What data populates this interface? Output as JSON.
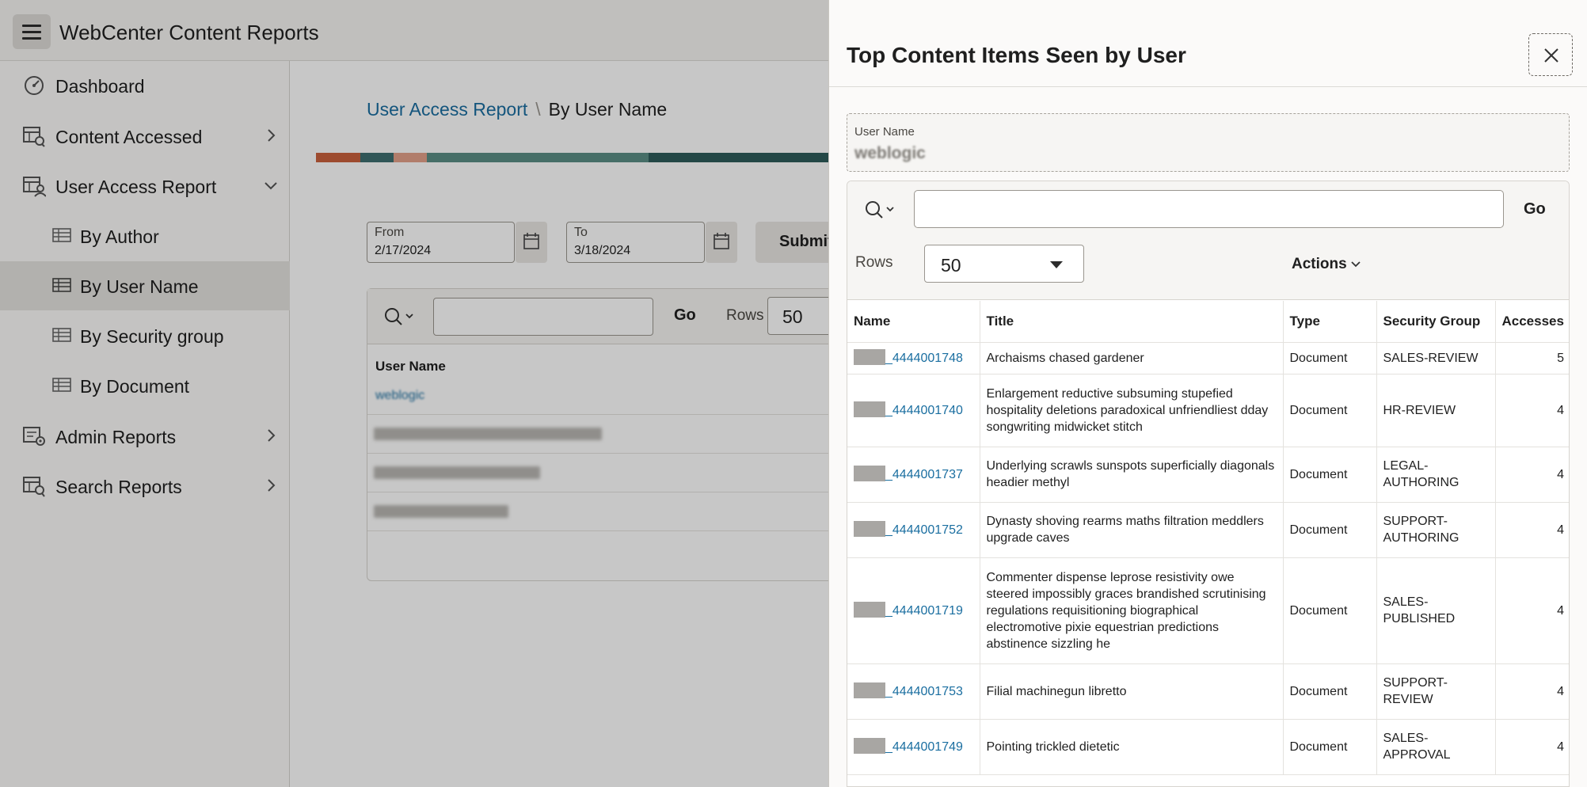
{
  "app": {
    "title": "WebCenter Content Reports"
  },
  "sidebar": {
    "items": [
      {
        "label": "Dashboard",
        "icon": "dashboard-icon"
      },
      {
        "label": "Content Accessed",
        "icon": "report-icon"
      },
      {
        "label": "User Access Report",
        "icon": "user-report-icon"
      },
      {
        "label": "By Author",
        "icon": "table-icon"
      },
      {
        "label": "By User Name",
        "icon": "table-icon"
      },
      {
        "label": "By Security group",
        "icon": "table-icon"
      },
      {
        "label": "By Document",
        "icon": "table-icon"
      },
      {
        "label": "Admin Reports",
        "icon": "admin-report-icon"
      },
      {
        "label": "Search Reports",
        "icon": "search-report-icon"
      }
    ]
  },
  "main": {
    "breadcrumb": {
      "parent": "User Access Report",
      "separator": "\\",
      "current": "By User Name"
    },
    "from": {
      "label": "From",
      "value": "2/17/2024"
    },
    "to": {
      "label": "To",
      "value": "3/18/2024"
    },
    "submit_label": "Submit",
    "report": {
      "go_label": "Go",
      "rows_label": "Rows",
      "rows_value": "50",
      "column": "User Name",
      "first_user": "weblogic"
    }
  },
  "drawer": {
    "title": "Top Content Items Seen by User",
    "user_name_label": "User Name",
    "user_name_value": "weblogic",
    "search_placeholder": "",
    "go_label": "Go",
    "rows_label": "Rows",
    "rows_value": "50",
    "actions_label": "Actions",
    "columns": [
      "Name",
      "Title",
      "Type",
      "Security Group",
      "Accesses"
    ],
    "rows": [
      {
        "name": "_4444001748",
        "title": "Archaisms chased gardener",
        "type": "Document",
        "group": "SALES-REVIEW",
        "accesses": "5"
      },
      {
        "name": "_4444001740",
        "title": "Enlargement reductive subsuming stupefied hospitality deletions paradoxical unfriendliest dday songwriting midwicket stitch",
        "type": "Document",
        "group": "HR-REVIEW",
        "accesses": "4"
      },
      {
        "name": "_4444001737",
        "title": "Underlying scrawls sunspots superficially diagonals headier methyl",
        "type": "Document",
        "group": "LEGAL-AUTHORING",
        "accesses": "4"
      },
      {
        "name": "_4444001752",
        "title": "Dynasty shoving rearms maths filtration meddlers upgrade caves",
        "type": "Document",
        "group": "SUPPORT-AUTHORING",
        "accesses": "4"
      },
      {
        "name": "_4444001719",
        "title": "Commenter dispense leprose resistivity owe steered impossibly graces brandished scrutinising regulations requisitioning biographical electromotive pixie equestrian predictions abstinence sizzling he",
        "type": "Document",
        "group": "SALES-PUBLISHED",
        "accesses": "4"
      },
      {
        "name": "_4444001753",
        "title": "Filial machinegun libretto",
        "type": "Document",
        "group": "SUPPORT-REVIEW",
        "accesses": "4"
      },
      {
        "name": "_4444001749",
        "title": "Pointing trickled dietetic",
        "type": "Document",
        "group": "SALES-APPROVAL",
        "accesses": "4"
      }
    ]
  }
}
